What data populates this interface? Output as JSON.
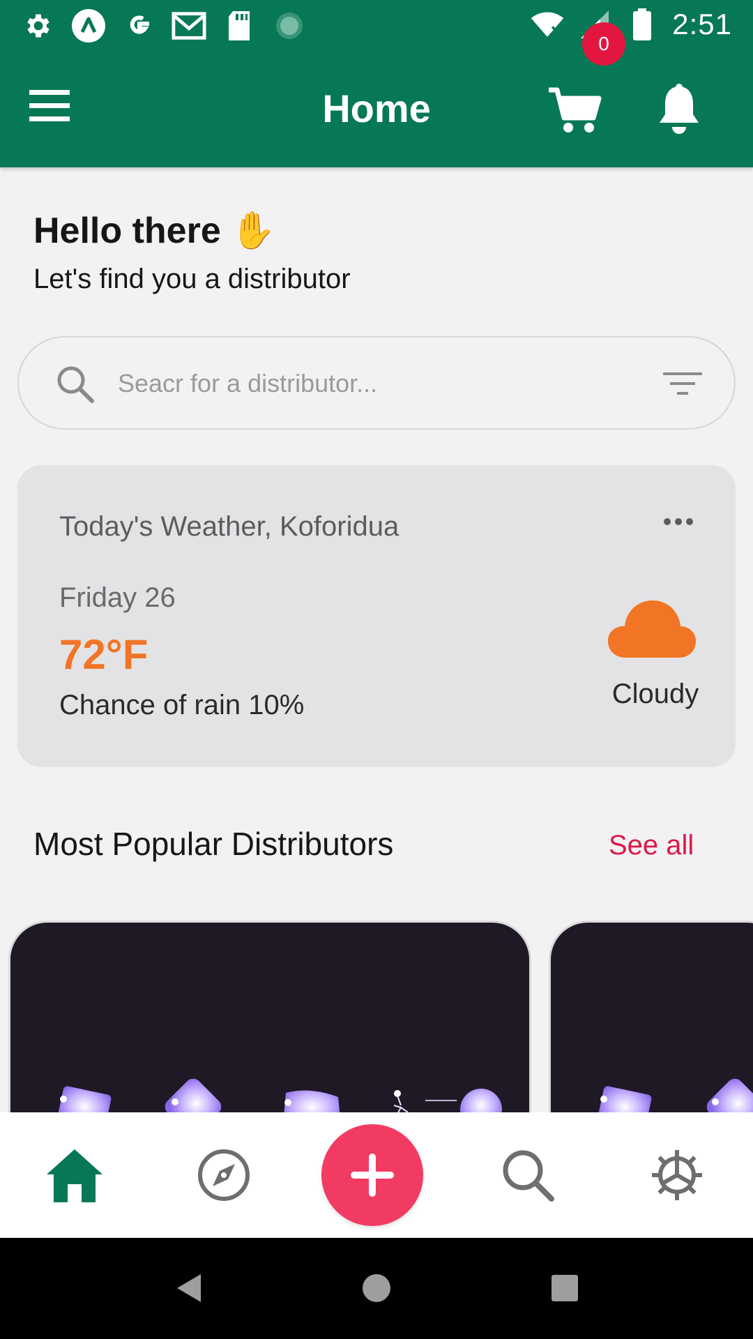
{
  "status_bar": {
    "time": "2:51",
    "left_icons": [
      "settings-icon",
      "app-a-icon",
      "google-icon",
      "gmail-icon",
      "sd-card-icon",
      "loading-icon"
    ],
    "right_icons": [
      "wifi-icon",
      "signal-icon",
      "battery-icon"
    ]
  },
  "app_bar": {
    "title": "Home",
    "cart_count": "0",
    "icons": [
      "menu-icon",
      "cart-icon",
      "bell-icon"
    ]
  },
  "greeting": {
    "title": "Hello there",
    "emoji": "✋",
    "subtitle": "Let's find you a distributor"
  },
  "search": {
    "placeholder": "Seacr for a distributor..."
  },
  "weather": {
    "location": "Today's Weather, Koforidua",
    "day": "Friday 26",
    "temperature": "72°F",
    "rain": "Chance of rain 10%",
    "condition": "Cloudy",
    "icon": "cloud-icon"
  },
  "popular": {
    "title": "Most Popular Distributors",
    "see_all": "See all"
  },
  "bottom_nav": {
    "items": [
      "home-icon",
      "explore-icon",
      "add-icon",
      "search-icon",
      "settings-icon"
    ]
  },
  "colors": {
    "primary": "#077856",
    "accent": "#f23b62",
    "badge": "#e3163f",
    "temperature": "#f17524",
    "see_all": "#dc1848"
  }
}
